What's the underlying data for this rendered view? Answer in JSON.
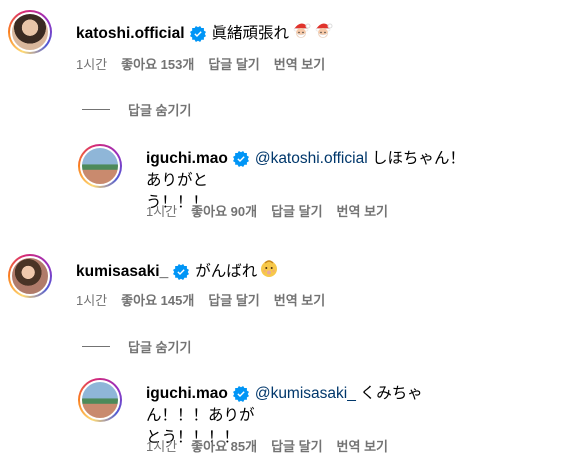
{
  "comments": [
    {
      "username": "katoshi.official",
      "text": "眞緒頑張れ",
      "emojis": [
        "santa-emoji",
        "santa-emoji"
      ],
      "time": "1시간",
      "likes": "좋아요 153개",
      "reply": "답글 달기",
      "translate": "번역 보기",
      "toggle": "답글 숨기기",
      "reply_comment": {
        "username": "iguchi.mao",
        "mention": "@katoshi.official",
        "text_line1": " しほちゃん！ありがと",
        "text_line2": "う！！！",
        "time": "1시간",
        "likes": "좋아요 90개",
        "reply": "답글 달기",
        "translate": "번역 보기"
      }
    },
    {
      "username": "kumisasaki_",
      "text": "がんばれ",
      "emojis": [
        "baby-emoji"
      ],
      "time": "1시간",
      "likes": "좋아요 145개",
      "reply": "답글 달기",
      "translate": "번역 보기",
      "toggle": "답글 숨기기",
      "reply_comment": {
        "username": "iguchi.mao",
        "mention": "@kumisasaki_",
        "text_line1": " くみちゃん！！！ありが",
        "text_line2": "とう！！！！",
        "time": "1시간",
        "likes": "좋아요 85개",
        "reply": "답글 달기",
        "translate": "번역 보기"
      }
    }
  ],
  "colors": {
    "verified": "#0095f6",
    "mention": "#00376b",
    "meta": "#737373"
  }
}
